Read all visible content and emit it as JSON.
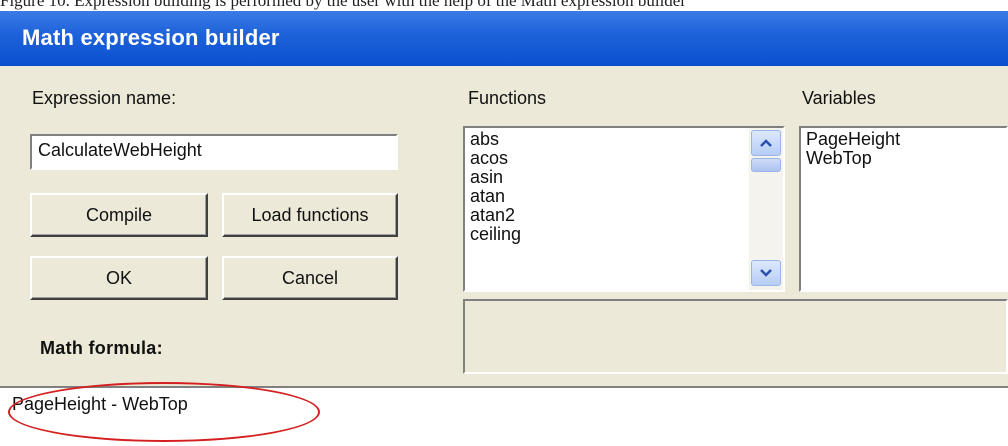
{
  "top_strip_text": "Figure 10. Expression building is performed by the user with the help of the Math expression builder",
  "window": {
    "title": "Math expression builder"
  },
  "expression_name": {
    "label": "Expression name:",
    "value": "CalculateWebHeight"
  },
  "buttons": {
    "compile": "Compile",
    "load_functions": "Load functions",
    "ok": "OK",
    "cancel": "Cancel"
  },
  "functions": {
    "label": "Functions",
    "items": [
      "abs",
      "acos",
      "asin",
      "atan",
      "atan2",
      "ceiling"
    ]
  },
  "variables": {
    "label": "Variables",
    "items": [
      "PageHeight",
      "WebTop"
    ]
  },
  "formula": {
    "label": "Math formula:",
    "value": "PageHeight - WebTop"
  },
  "colors": {
    "title_bar": "#0a4fd0",
    "dialog_bg": "#ece9d8",
    "annotation": "#d42020"
  },
  "icons": [
    "scroll-up-icon",
    "scroll-down-icon"
  ]
}
